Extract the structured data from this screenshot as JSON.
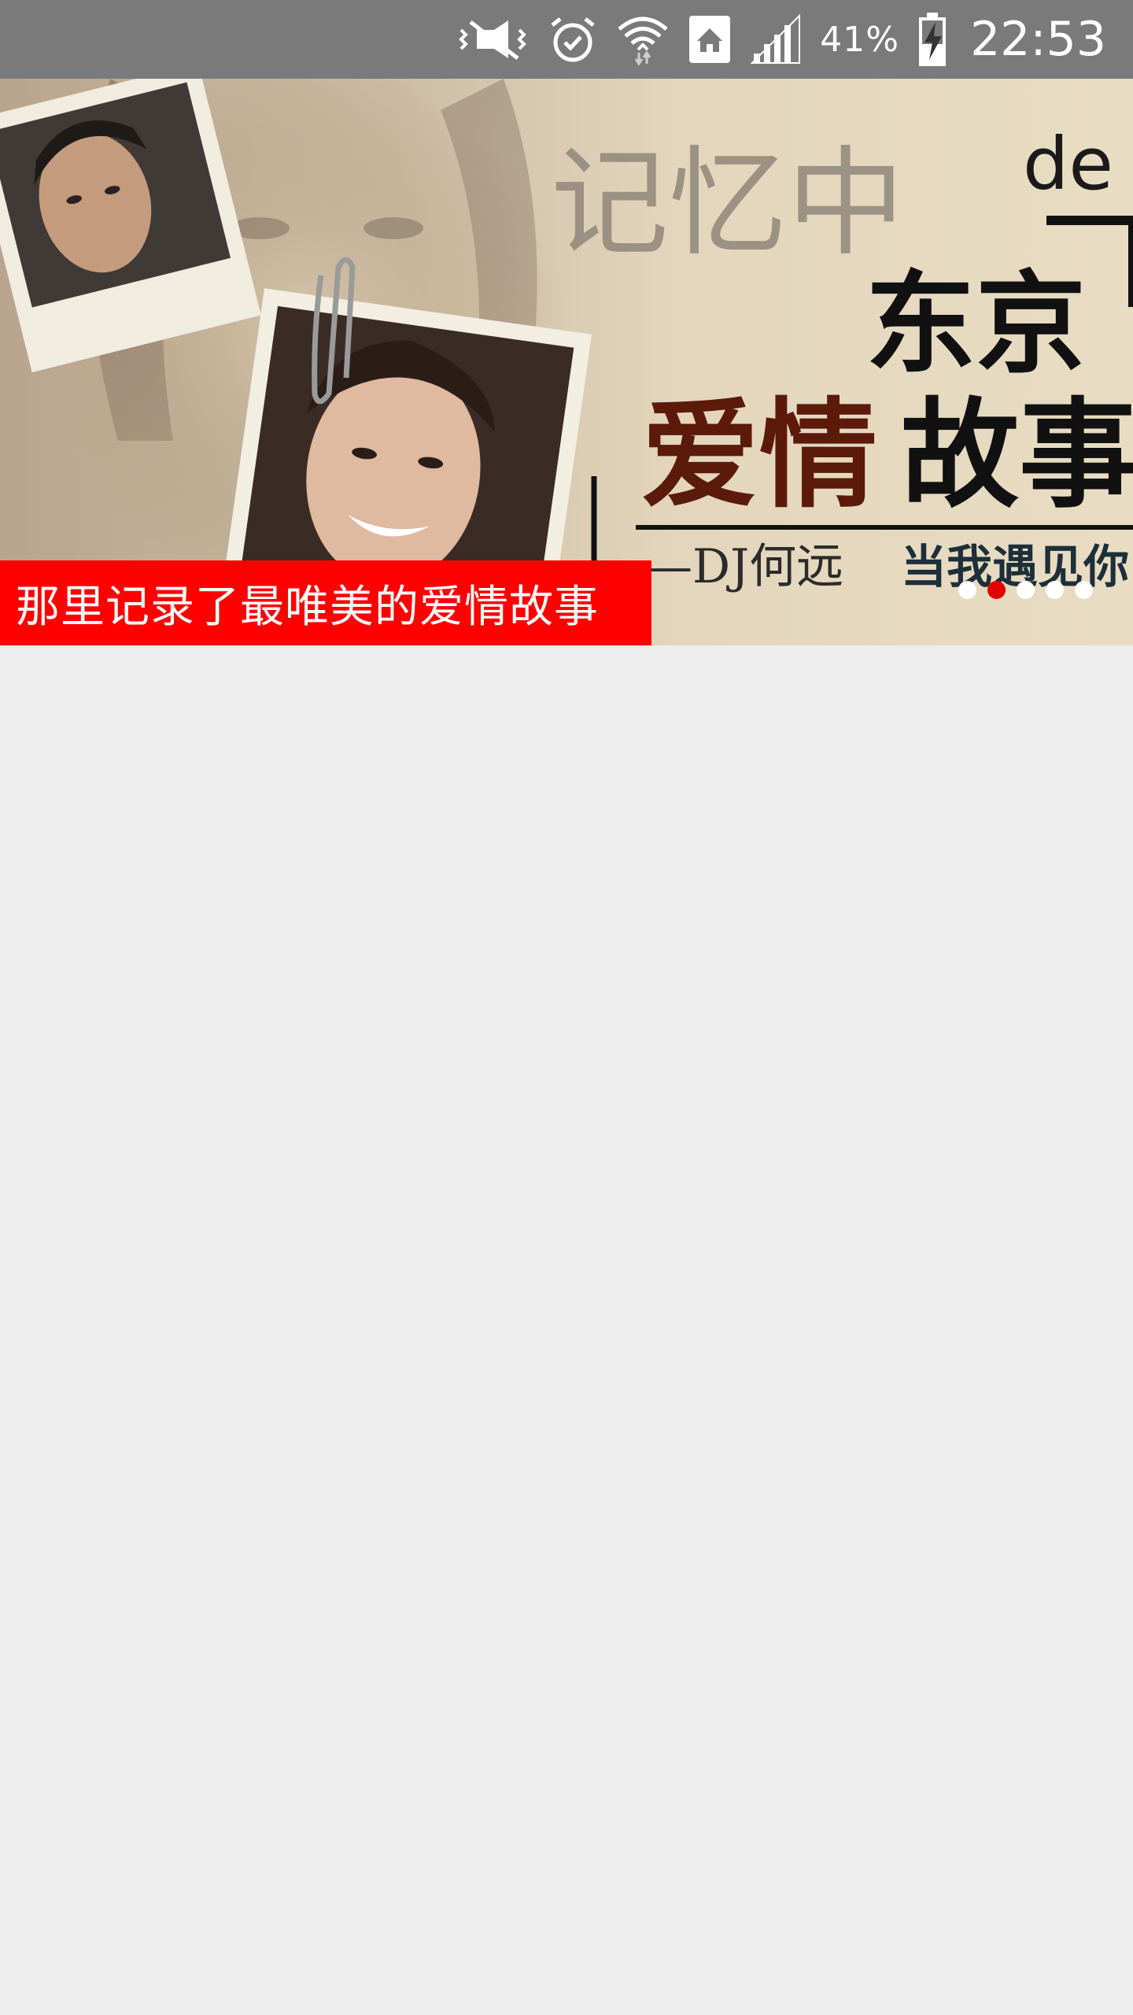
{
  "status_bar": {
    "battery_percent": "41%",
    "time": "22:53",
    "icons": [
      "mute-vibrate-icon",
      "alarm-icon",
      "wifi-icon",
      "home-icon",
      "signal-icon",
      "battery-charging-icon"
    ]
  },
  "banner": {
    "caption": "那里记录了最唯美的爱情故事",
    "art_text": {
      "title_small": "记忆中",
      "title_de": "de",
      "title_line1": "东京",
      "title_line2_red": "爱情",
      "title_line2_black": "故事",
      "byline": "—DJ何远",
      "tagline": "当我遇见你"
    },
    "page_count": 5,
    "current_page": 1,
    "colors": {
      "caption_bg": "#ff0000",
      "indicator_active": "#e30000",
      "indicator_inactive": "#ffffff"
    }
  }
}
